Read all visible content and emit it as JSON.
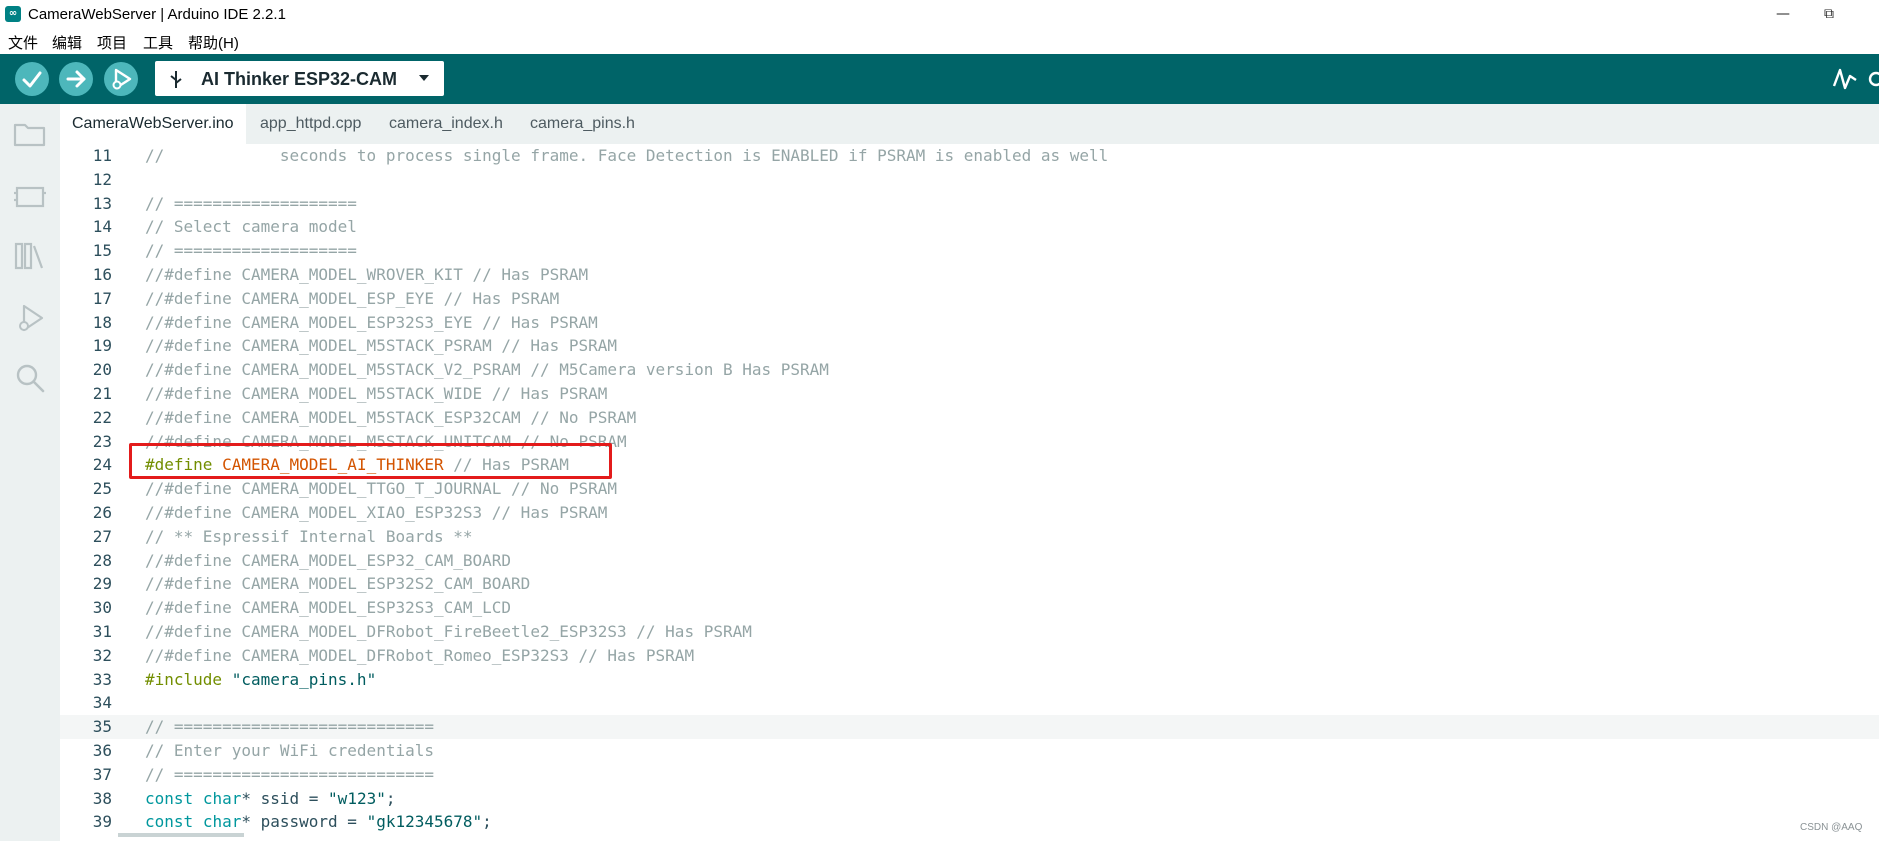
{
  "window": {
    "title": "CameraWebServer | Arduino IDE 2.2.1",
    "logo": "∞",
    "minimize": "—",
    "restore": "⧉"
  },
  "menu": [
    "文件",
    "编辑",
    "项目",
    "工具",
    "帮助(H)"
  ],
  "toolbar": {
    "board": "AI Thinker ESP32-CAM",
    "verify_icon": "check-icon",
    "upload_icon": "arrow-right-icon",
    "debug_icon": "debugger-icon"
  },
  "tabs": [
    {
      "label": "CameraWebServer.ino",
      "active": true
    },
    {
      "label": "app_httpd.cpp",
      "active": false
    },
    {
      "label": "camera_index.h",
      "active": false
    },
    {
      "label": "camera_pins.h",
      "active": false
    }
  ],
  "editor": {
    "lines": [
      {
        "num": "11",
        "text": "//            seconds to process single frame. Face Detection is ENABLED if PSRAM is enabled as well"
      },
      {
        "num": "12",
        "text": ""
      },
      {
        "num": "13",
        "text": "// ==================="
      },
      {
        "num": "14",
        "text": "// Select camera model"
      },
      {
        "num": "15",
        "text": "// ==================="
      },
      {
        "num": "16",
        "text": "//#define CAMERA_MODEL_WROVER_KIT // Has PSRAM"
      },
      {
        "num": "17",
        "text": "//#define CAMERA_MODEL_ESP_EYE // Has PSRAM"
      },
      {
        "num": "18",
        "text": "//#define CAMERA_MODEL_ESP32S3_EYE // Has PSRAM"
      },
      {
        "num": "19",
        "text": "//#define CAMERA_MODEL_M5STACK_PSRAM // Has PSRAM"
      },
      {
        "num": "20",
        "text": "//#define CAMERA_MODEL_M5STACK_V2_PSRAM // M5Camera version B Has PSRAM"
      },
      {
        "num": "21",
        "text": "//#define CAMERA_MODEL_M5STACK_WIDE // Has PSRAM"
      },
      {
        "num": "22",
        "text": "//#define CAMERA_MODEL_M5STACK_ESP32CAM // No PSRAM"
      },
      {
        "num": "23",
        "text": "//#define CAMERA_MODEL_M5STACK_UNITCAM // No PSRAM"
      },
      {
        "num": "24",
        "define": "#define",
        "macro": "CAMERA_MODEL_AI_THINKER",
        "comment": "// Has PSRAM"
      },
      {
        "num": "25",
        "text": "//#define CAMERA_MODEL_TTGO_T_JOURNAL // No PSRAM"
      },
      {
        "num": "26",
        "text": "//#define CAMERA_MODEL_XIAO_ESP32S3 // Has PSRAM"
      },
      {
        "num": "27",
        "text": "// ** Espressif Internal Boards **"
      },
      {
        "num": "28",
        "text": "//#define CAMERA_MODEL_ESP32_CAM_BOARD"
      },
      {
        "num": "29",
        "text": "//#define CAMERA_MODEL_ESP32S2_CAM_BOARD"
      },
      {
        "num": "30",
        "text": "//#define CAMERA_MODEL_ESP32S3_CAM_LCD"
      },
      {
        "num": "31",
        "text": "//#define CAMERA_MODEL_DFRobot_FireBeetle2_ESP32S3 // Has PSRAM"
      },
      {
        "num": "32",
        "text": "//#define CAMERA_MODEL_DFRobot_Romeo_ESP32S3 // Has PSRAM"
      },
      {
        "num": "33",
        "include": "#include",
        "file": "\"camera_pins.h\""
      },
      {
        "num": "34",
        "text": ""
      },
      {
        "num": "35",
        "text": "// ==========================="
      },
      {
        "num": "36",
        "text": "// Enter your WiFi credentials"
      },
      {
        "num": "37",
        "text": "// ==========================="
      },
      {
        "num": "38",
        "const": "const",
        "type": "char",
        "rest": "* ssid = ",
        "value": "\"w123\"",
        "end": ";"
      },
      {
        "num": "39",
        "const": "const",
        "type": "char",
        "rest": "* password = ",
        "value": "\"gk12345678\"",
        "end": ";"
      }
    ]
  },
  "watermark": "CSDN @AAQ",
  "colors": {
    "toolbar_bg": "#006468",
    "button_bg": "#4db7bb",
    "highlight_border": "#e31b1b"
  }
}
